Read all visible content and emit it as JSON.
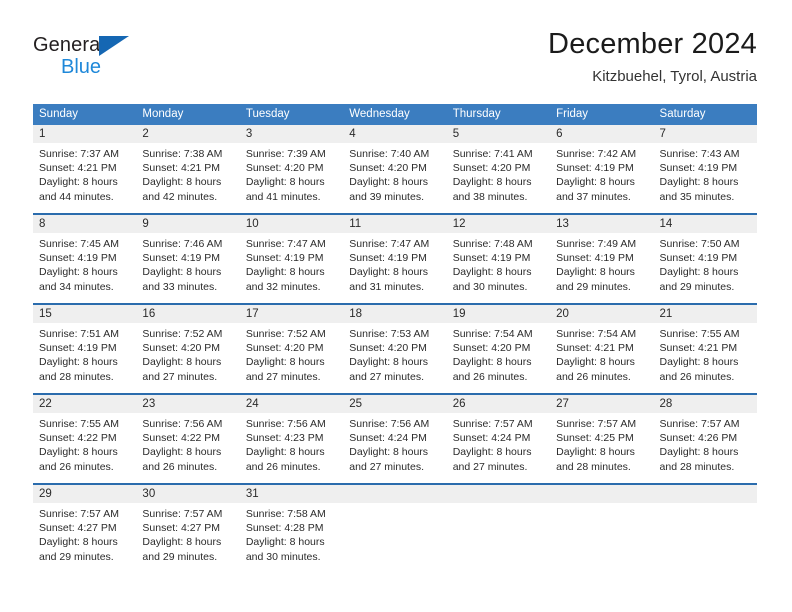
{
  "brand": {
    "name_top": "General",
    "name_bottom": "Blue",
    "accent_color": "#1567b3",
    "blue_text_color": "#1f88d9"
  },
  "header": {
    "month_title": "December 2024",
    "location": "Kitzbuehel, Tyrol, Austria"
  },
  "calendar": {
    "header_bg": "#3b7dc0",
    "row_divider_color": "#2b6cad",
    "number_band_bg": "#efefef",
    "weekdays": [
      "Sunday",
      "Monday",
      "Tuesday",
      "Wednesday",
      "Thursday",
      "Friday",
      "Saturday"
    ],
    "weeks": [
      {
        "days": [
          {
            "num": "1",
            "lines": [
              "Sunrise: 7:37 AM",
              "Sunset: 4:21 PM",
              "Daylight: 8 hours",
              "and 44 minutes."
            ]
          },
          {
            "num": "2",
            "lines": [
              "Sunrise: 7:38 AM",
              "Sunset: 4:21 PM",
              "Daylight: 8 hours",
              "and 42 minutes."
            ]
          },
          {
            "num": "3",
            "lines": [
              "Sunrise: 7:39 AM",
              "Sunset: 4:20 PM",
              "Daylight: 8 hours",
              "and 41 minutes."
            ]
          },
          {
            "num": "4",
            "lines": [
              "Sunrise: 7:40 AM",
              "Sunset: 4:20 PM",
              "Daylight: 8 hours",
              "and 39 minutes."
            ]
          },
          {
            "num": "5",
            "lines": [
              "Sunrise: 7:41 AM",
              "Sunset: 4:20 PM",
              "Daylight: 8 hours",
              "and 38 minutes."
            ]
          },
          {
            "num": "6",
            "lines": [
              "Sunrise: 7:42 AM",
              "Sunset: 4:19 PM",
              "Daylight: 8 hours",
              "and 37 minutes."
            ]
          },
          {
            "num": "7",
            "lines": [
              "Sunrise: 7:43 AM",
              "Sunset: 4:19 PM",
              "Daylight: 8 hours",
              "and 35 minutes."
            ]
          }
        ]
      },
      {
        "days": [
          {
            "num": "8",
            "lines": [
              "Sunrise: 7:45 AM",
              "Sunset: 4:19 PM",
              "Daylight: 8 hours",
              "and 34 minutes."
            ]
          },
          {
            "num": "9",
            "lines": [
              "Sunrise: 7:46 AM",
              "Sunset: 4:19 PM",
              "Daylight: 8 hours",
              "and 33 minutes."
            ]
          },
          {
            "num": "10",
            "lines": [
              "Sunrise: 7:47 AM",
              "Sunset: 4:19 PM",
              "Daylight: 8 hours",
              "and 32 minutes."
            ]
          },
          {
            "num": "11",
            "lines": [
              "Sunrise: 7:47 AM",
              "Sunset: 4:19 PM",
              "Daylight: 8 hours",
              "and 31 minutes."
            ]
          },
          {
            "num": "12",
            "lines": [
              "Sunrise: 7:48 AM",
              "Sunset: 4:19 PM",
              "Daylight: 8 hours",
              "and 30 minutes."
            ]
          },
          {
            "num": "13",
            "lines": [
              "Sunrise: 7:49 AM",
              "Sunset: 4:19 PM",
              "Daylight: 8 hours",
              "and 29 minutes."
            ]
          },
          {
            "num": "14",
            "lines": [
              "Sunrise: 7:50 AM",
              "Sunset: 4:19 PM",
              "Daylight: 8 hours",
              "and 29 minutes."
            ]
          }
        ]
      },
      {
        "days": [
          {
            "num": "15",
            "lines": [
              "Sunrise: 7:51 AM",
              "Sunset: 4:19 PM",
              "Daylight: 8 hours",
              "and 28 minutes."
            ]
          },
          {
            "num": "16",
            "lines": [
              "Sunrise: 7:52 AM",
              "Sunset: 4:20 PM",
              "Daylight: 8 hours",
              "and 27 minutes."
            ]
          },
          {
            "num": "17",
            "lines": [
              "Sunrise: 7:52 AM",
              "Sunset: 4:20 PM",
              "Daylight: 8 hours",
              "and 27 minutes."
            ]
          },
          {
            "num": "18",
            "lines": [
              "Sunrise: 7:53 AM",
              "Sunset: 4:20 PM",
              "Daylight: 8 hours",
              "and 27 minutes."
            ]
          },
          {
            "num": "19",
            "lines": [
              "Sunrise: 7:54 AM",
              "Sunset: 4:20 PM",
              "Daylight: 8 hours",
              "and 26 minutes."
            ]
          },
          {
            "num": "20",
            "lines": [
              "Sunrise: 7:54 AM",
              "Sunset: 4:21 PM",
              "Daylight: 8 hours",
              "and 26 minutes."
            ]
          },
          {
            "num": "21",
            "lines": [
              "Sunrise: 7:55 AM",
              "Sunset: 4:21 PM",
              "Daylight: 8 hours",
              "and 26 minutes."
            ]
          }
        ]
      },
      {
        "days": [
          {
            "num": "22",
            "lines": [
              "Sunrise: 7:55 AM",
              "Sunset: 4:22 PM",
              "Daylight: 8 hours",
              "and 26 minutes."
            ]
          },
          {
            "num": "23",
            "lines": [
              "Sunrise: 7:56 AM",
              "Sunset: 4:22 PM",
              "Daylight: 8 hours",
              "and 26 minutes."
            ]
          },
          {
            "num": "24",
            "lines": [
              "Sunrise: 7:56 AM",
              "Sunset: 4:23 PM",
              "Daylight: 8 hours",
              "and 26 minutes."
            ]
          },
          {
            "num": "25",
            "lines": [
              "Sunrise: 7:56 AM",
              "Sunset: 4:24 PM",
              "Daylight: 8 hours",
              "and 27 minutes."
            ]
          },
          {
            "num": "26",
            "lines": [
              "Sunrise: 7:57 AM",
              "Sunset: 4:24 PM",
              "Daylight: 8 hours",
              "and 27 minutes."
            ]
          },
          {
            "num": "27",
            "lines": [
              "Sunrise: 7:57 AM",
              "Sunset: 4:25 PM",
              "Daylight: 8 hours",
              "and 28 minutes."
            ]
          },
          {
            "num": "28",
            "lines": [
              "Sunrise: 7:57 AM",
              "Sunset: 4:26 PM",
              "Daylight: 8 hours",
              "and 28 minutes."
            ]
          }
        ]
      },
      {
        "days": [
          {
            "num": "29",
            "lines": [
              "Sunrise: 7:57 AM",
              "Sunset: 4:27 PM",
              "Daylight: 8 hours",
              "and 29 minutes."
            ]
          },
          {
            "num": "30",
            "lines": [
              "Sunrise: 7:57 AM",
              "Sunset: 4:27 PM",
              "Daylight: 8 hours",
              "and 29 minutes."
            ]
          },
          {
            "num": "31",
            "lines": [
              "Sunrise: 7:58 AM",
              "Sunset: 4:28 PM",
              "Daylight: 8 hours",
              "and 30 minutes."
            ]
          },
          {
            "num": "",
            "lines": []
          },
          {
            "num": "",
            "lines": []
          },
          {
            "num": "",
            "lines": []
          },
          {
            "num": "",
            "lines": []
          }
        ]
      }
    ]
  }
}
